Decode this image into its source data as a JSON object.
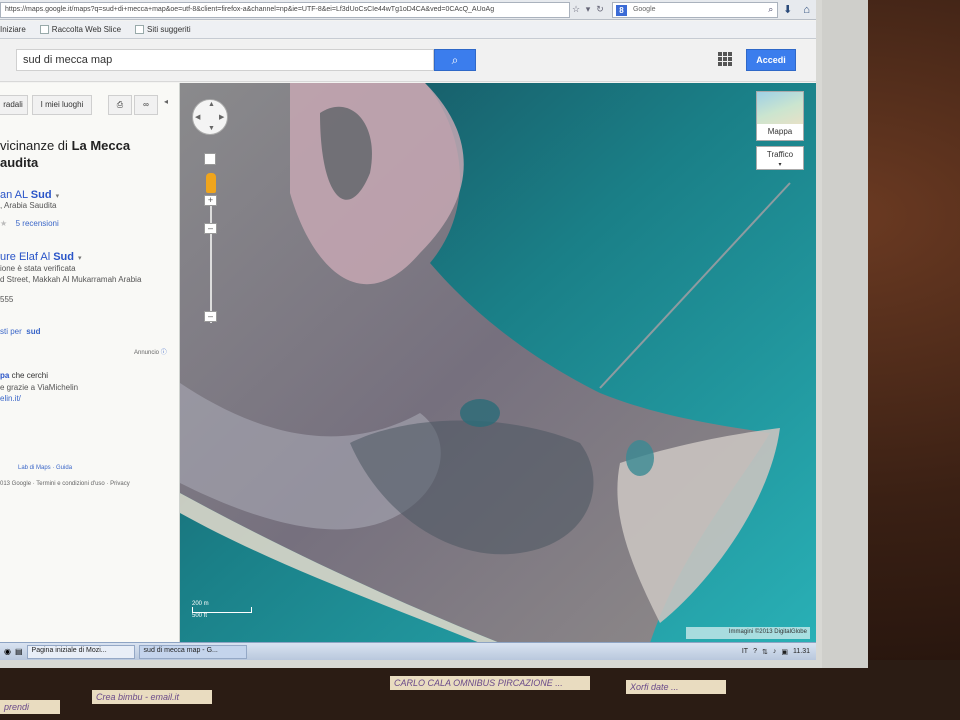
{
  "browser": {
    "url": "https://maps.google.it/maps?q=sud+di+mecca+map&oe=utf-8&client=firefox-a&channel=np&ie=UTF-8&ei=Lf3dUoCsCIe44wTg1oD4CA&ved=0CAcQ_AUoAg",
    "search_engine": "Google",
    "bookmarks": [
      "Iniziare",
      "Raccolta Web Slice",
      "Siti suggeriti"
    ]
  },
  "header": {
    "query": "sud di mecca map",
    "signin_label": "Accedi"
  },
  "panel": {
    "btn_left": "radali",
    "btn_my_places": "I miei luoghi",
    "title_prefix": "vicinanze di",
    "title_bold": "La Mecca",
    "title_line2": "audita",
    "result1": {
      "name_prefix": "an AL",
      "name_bold": "Sud",
      "place": ", Arabia Saudita",
      "reviews": "5 recensioni"
    },
    "result2": {
      "name_prefix": "ure Elaf Al",
      "name_bold": "Sud",
      "verified": "ione è stata verificata",
      "address": "d Street, Makkah Al Mukarramah Arabia",
      "phone": "555"
    },
    "more_results_prefix": "sti per",
    "more_results_bold": "sud",
    "sponsored": "Annuncio",
    "ad_line1_bold": "pa",
    "ad_line1_rest": " che cerchi",
    "ad_line2": "e grazie a ViaMichelin",
    "ad_line3": "elin.it/",
    "footer_links": "Lab di Maps · Guida",
    "footer_copy": "013 Google · Termini e condizioni d'uso · Privacy"
  },
  "map": {
    "layer_label": "Mappa",
    "traffic_label": "Traffico",
    "scale_metric": "200 m",
    "scale_imperial": "500 ft",
    "credit": "Immagini ©2013 DigitalGlobe"
  },
  "taskbar": {
    "tasks": [
      "Pagina iniziale di Mozi...",
      "sud di mecca map - G..."
    ],
    "lang": "IT",
    "clock": "11.31"
  },
  "notes": [
    "prendi",
    "Crea bimbu - email.it",
    "CARLO CALA OMNIBUS PIRCAZIONE ...",
    "Xorfi date ..."
  ]
}
